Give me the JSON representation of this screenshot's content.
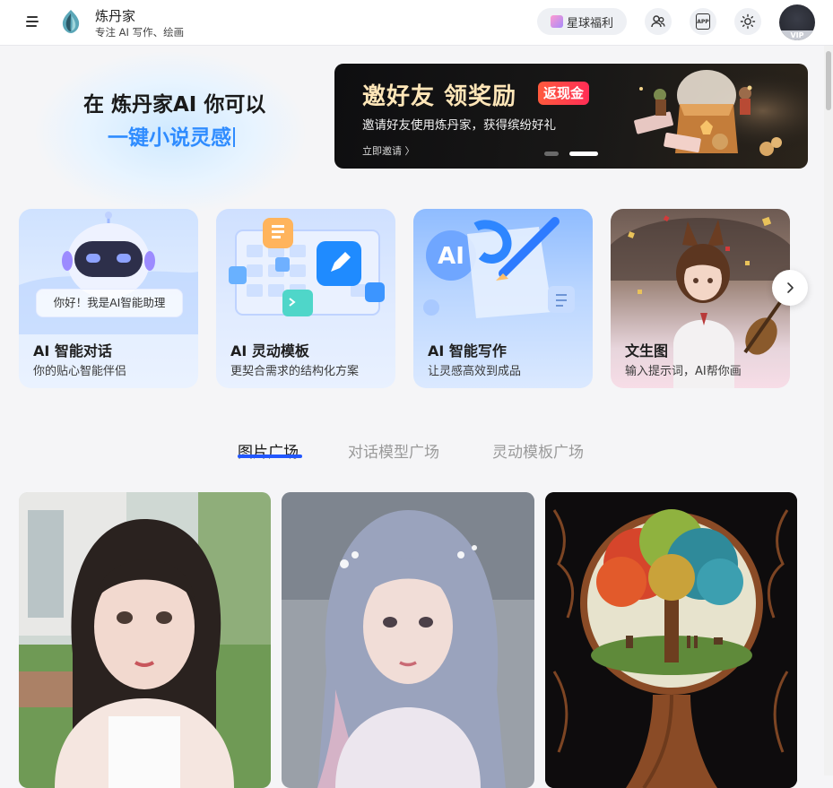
{
  "header": {
    "brand_name": "炼丹家",
    "brand_tagline": "专注 AI 写作、绘画",
    "perk_label": "星球福利",
    "app_label": "APP",
    "vip_label": "VIP"
  },
  "hero": {
    "line1": "在 炼丹家AI 你可以",
    "line2": "一键小说灵感"
  },
  "banner": {
    "title": "邀好友 领奖励",
    "badge": "返现金",
    "subtitle": "邀请好友使用炼丹家，获得缤纷好礼",
    "cta": "立即邀请 〉",
    "dots": [
      "inactive",
      "active"
    ]
  },
  "features": [
    {
      "title": "AI 智能对话",
      "desc": "你的贴心智能伴侣",
      "bubble": "你好！我是AI智能助理"
    },
    {
      "title": "AI 灵动模板",
      "desc": "更契合需求的结构化方案"
    },
    {
      "title": "AI 智能写作",
      "desc": "让灵感高效到成品",
      "badge": "AI"
    },
    {
      "title": "文生图",
      "desc": "输入提示词，AI帮你画"
    }
  ],
  "tabs": [
    {
      "label": "图片广场",
      "active": true
    },
    {
      "label": "对话模型广场",
      "active": false
    },
    {
      "label": "灵动模板广场",
      "active": false
    }
  ],
  "gallery": [
    {
      "subject": "portrait-girl-dark-hair"
    },
    {
      "subject": "portrait-girl-silver-hair"
    },
    {
      "subject": "tree-of-seasons"
    }
  ],
  "colors": {
    "accent_blue": "#2f8cff",
    "tab_underline": "#2257ff",
    "banner_gold": "#ffe6b8",
    "badge_red": "#ff2d55"
  }
}
